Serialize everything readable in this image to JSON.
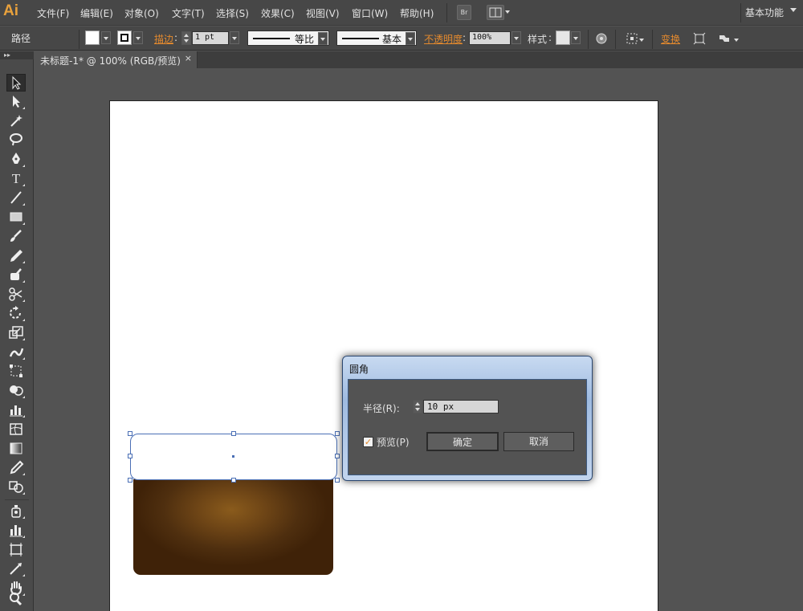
{
  "app": {
    "logo": "Ai"
  },
  "menubar": {
    "items": [
      "文件(F)",
      "编辑(E)",
      "对象(O)",
      "文字(T)",
      "选择(S)",
      "效果(C)",
      "视图(V)",
      "窗口(W)",
      "帮助(H)"
    ],
    "bridge_label": "Br",
    "workspace": "基本功能"
  },
  "controlbar": {
    "object_type": "路径",
    "stroke_label": "描边",
    "stroke_weight": "1 pt",
    "stroke_profile": "等比",
    "brush_definition": "基本",
    "opacity_label": "不透明度",
    "opacity_value": "100%",
    "style_label": "样式",
    "transform_label": "变换"
  },
  "tab": {
    "title": "未标题-1* @ 100% (RGB/预览)",
    "close": "×"
  },
  "dialog": {
    "title": "圆角",
    "radius_label": "半径(R):",
    "radius_value": "10 px",
    "preview_label": "预览(P)",
    "preview_checked": true,
    "ok_label": "确定",
    "cancel_label": "取消"
  },
  "tools": [
    "selection-tool",
    "direct-selection-tool",
    "magic-wand-tool",
    "lasso-tool",
    "pen-tool",
    "type-tool",
    "line-segment-tool",
    "rectangle-tool",
    "paintbrush-tool",
    "pencil-tool",
    "blob-brush-tool",
    "scissors-tool",
    "rotate-tool",
    "scale-tool",
    "warp-tool",
    "free-transform-tool",
    "shape-builder-tool",
    "graph-tool",
    "mesh-tool",
    "gradient-tool",
    "eyedropper-tool",
    "blend-tool",
    "symbol-sprayer-tool",
    "column-graph-tool",
    "artboard-tool",
    "slice-tool",
    "hand-tool",
    "zoom-tool"
  ],
  "colors": {
    "accent_orange": "#e48a2e",
    "selection_blue": "#4a6fb5",
    "fill_brown": "#6e4516"
  }
}
